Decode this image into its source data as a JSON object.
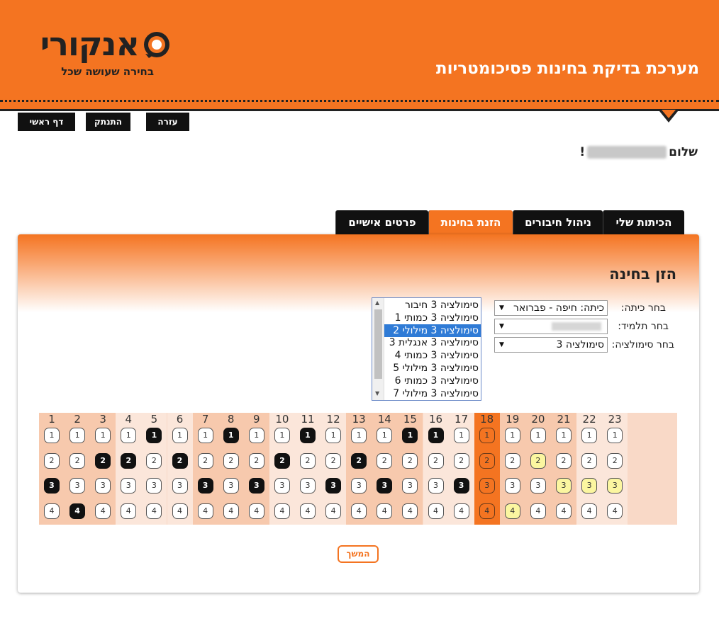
{
  "brand": {
    "logo_text": "אנקורי",
    "tagline": "בחירה שעושה שכל",
    "app_title": "מערכת בדיקת בחינות פסיכומטריות",
    "accent_color": "#f47421"
  },
  "topnav": {
    "help": "עזרה",
    "logout": "התנתק",
    "home": "דף ראשי"
  },
  "greeting": {
    "prefix": "שלום",
    "suffix": "!"
  },
  "tabs": [
    {
      "label": "הכיתות שלי",
      "active": false
    },
    {
      "label": "ניהול חיבורים",
      "active": false
    },
    {
      "label": "הזנת בחינות",
      "active": true
    },
    {
      "label": "פרטים אישיים",
      "active": false
    }
  ],
  "panel": {
    "title": "הזן בחינה",
    "class_label": "בחר כיתה:",
    "class_value": "כיתה: חיפה - פברואר",
    "student_label": "בחר תלמיד:",
    "student_value": "",
    "sim_label": "בחר סימולציה:",
    "sim_value": "סימולציה 3",
    "sections": [
      "סימולציה 3 חיבור",
      "סימולציה 3 כמותי 1",
      "סימולציה 3 מילולי 2",
      "סימולציה 3 אנגלית 3",
      "סימולציה 3 כמותי 4",
      "סימולציה 3 מילולי 5",
      "סימולציה 3 כמותי 6",
      "סימולציה 3 מילולי 7"
    ],
    "selected_section": "סימולציה 3 מילולי 2",
    "continue_label": "המשך"
  },
  "answer_grid": {
    "question_numbers": [
      "1",
      "2",
      "3",
      "4",
      "5",
      "6",
      "7",
      "8",
      "9",
      "10",
      "11",
      "12",
      "13",
      "14",
      "15",
      "16",
      "17",
      "18",
      "19",
      "20",
      "21",
      "22",
      "23"
    ],
    "choices": [
      "1",
      "2",
      "3",
      "4"
    ],
    "filled_answers": [
      3,
      4,
      2,
      2,
      1,
      2,
      3,
      1,
      3,
      2,
      1,
      3,
      2,
      3,
      1,
      1,
      3,
      null,
      null,
      null,
      null,
      null,
      null
    ],
    "current_question": 18,
    "highlighted": [
      {
        "question": 19,
        "choice": 4
      },
      {
        "question": 20,
        "choice": 2
      },
      {
        "question": 21,
        "choice": 3
      },
      {
        "question": 22,
        "choice": 3
      },
      {
        "question": 23,
        "choice": 3
      }
    ]
  }
}
